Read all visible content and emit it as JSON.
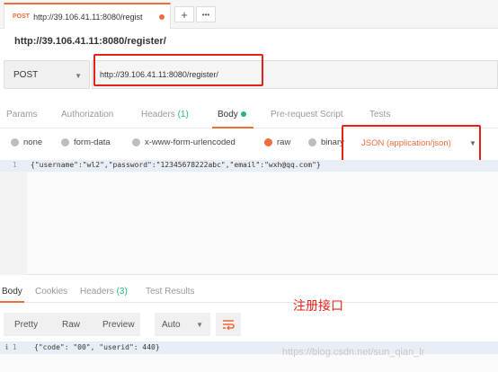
{
  "tabbar": {
    "tab_method": "POST",
    "tab_url": "http://39.106.41.11:8080/regist",
    "add_label": "+",
    "more_label": "•••"
  },
  "title": "http://39.106.41.11:8080/register/",
  "request": {
    "method": "POST",
    "url": "http://39.106.41.11:8080/register/"
  },
  "request_tabs": {
    "params": "Params",
    "authorization": "Authorization",
    "headers": "Headers",
    "headers_count": "(1)",
    "body": "Body",
    "prerequest": "Pre-request Script",
    "tests": "Tests"
  },
  "body_options": {
    "none": "none",
    "form_data": "form-data",
    "urlencoded": "x-www-form-urlencoded",
    "raw": "raw",
    "binary": "binary",
    "selected": "raw",
    "content_type": "JSON (application/json)"
  },
  "editor": {
    "line_number": "1",
    "code": "{\"username\":\"wl2\",\"password\":\"12345678222abc\",\"email\":\"wxh@qq.com\"}"
  },
  "response_tabs": {
    "body": "Body",
    "cookies": "Cookies",
    "headers": "Headers",
    "headers_count": "(3)",
    "test_results": "Test Results"
  },
  "annotation": "注册接口",
  "response_toolbar": {
    "pretty": "Pretty",
    "raw": "Raw",
    "preview": "Preview",
    "auto": "Auto"
  },
  "response": {
    "line_number": "1",
    "code": "{\"code\": \"00\", \"userid\": 440}"
  },
  "watermark": "https://blog.csdn.net/sun_qian_lr",
  "colors": {
    "accent": "#f26b3a",
    "annotation_red": "#e8201a",
    "count_green": "#26b47f"
  }
}
